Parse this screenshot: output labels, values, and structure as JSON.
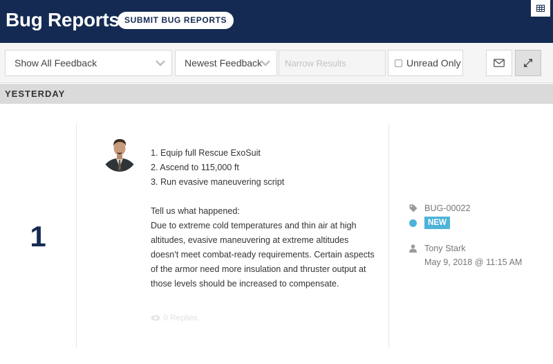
{
  "header": {
    "title": "Bug Reports",
    "submit_label": "SUBMIT BUG REPORTS",
    "grid_icon": "grid-icon"
  },
  "toolbar": {
    "filter_select": "Show All Feedback",
    "sort_select": "Newest Feedback",
    "narrow_placeholder": "Narrow Results",
    "unread_label": "Unread Only",
    "mail_icon": "envelope-icon",
    "expand_icon": "expand-icon"
  },
  "section": {
    "label": "YESTERDAY"
  },
  "feedback": {
    "count": "1",
    "steps": [
      "1. Equip full Rescue ExoSuit",
      "2. Ascend to 115,000 ft",
      "3. Run evasive maneuvering script"
    ],
    "question": "Tell us what happened:",
    "description": "Due to extreme cold temperatures and thin air at high altitudes, evasive maneuvering at extreme altitudes doesn't meet combat-ready requirements. Certain aspects of the armor need more insulation and thruster output at those levels should be increased to compensate.",
    "replies": "0 Replies",
    "bug_id": "BUG-00022",
    "status": "NEW",
    "author": "Tony Stark",
    "date": "May 9, 2018 @ 11:15 AM"
  },
  "colors": {
    "header_bg": "#142a52",
    "status_badge": "#4fb3d9",
    "section_bg": "#dadada"
  }
}
